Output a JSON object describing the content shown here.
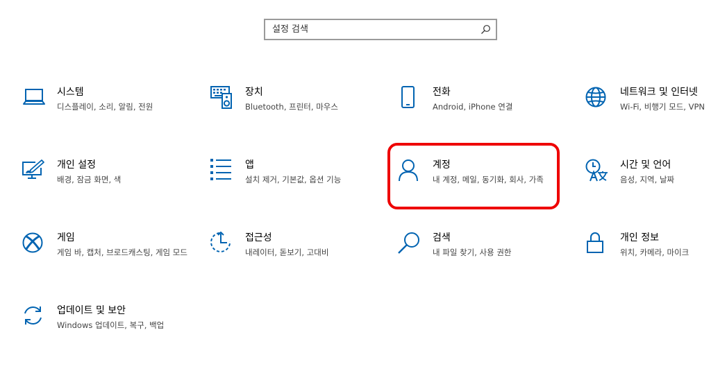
{
  "search": {
    "placeholder": "설정 검색",
    "value": ""
  },
  "accent": "#0063b1",
  "highlight_color": "#ee0000",
  "tiles": [
    {
      "icon": "laptop-icon",
      "title": "시스템",
      "desc": "디스플레이, 소리, 알림, 전원"
    },
    {
      "icon": "devices-icon",
      "title": "장치",
      "desc": "Bluetooth, 프린터, 마우스"
    },
    {
      "icon": "phone-icon",
      "title": "전화",
      "desc": "Android, iPhone 연결"
    },
    {
      "icon": "globe-icon",
      "title": "네트워크 및 인터넷",
      "desc": "Wi-Fi, 비행기 모드, VPN"
    },
    {
      "icon": "personalization-icon",
      "title": "개인 설정",
      "desc": "배경, 잠금 화면, 색"
    },
    {
      "icon": "apps-list-icon",
      "title": "앱",
      "desc": "설치 제거, 기본값, 옵션 기능"
    },
    {
      "icon": "person-icon",
      "title": "계정",
      "desc": "내 계정, 메일, 동기화, 회사, 가족"
    },
    {
      "icon": "time-language-icon",
      "title": "시간 및 언어",
      "desc": "음성, 지역, 날짜"
    },
    {
      "icon": "xbox-icon",
      "title": "게임",
      "desc": "게임 바, 캡처, 브로드캐스팅, 게임 모드"
    },
    {
      "icon": "ease-of-access-icon",
      "title": "접근성",
      "desc": "내레이터, 돋보기, 고대비"
    },
    {
      "icon": "search-icon",
      "title": "검색",
      "desc": "내 파일 찾기, 사용 권한"
    },
    {
      "icon": "lock-icon",
      "title": "개인 정보",
      "desc": "위치, 카메라, 마이크"
    },
    {
      "icon": "sync-icon",
      "title": "업데이트 및 보안",
      "desc": "Windows 업데이트, 복구, 백업"
    }
  ]
}
